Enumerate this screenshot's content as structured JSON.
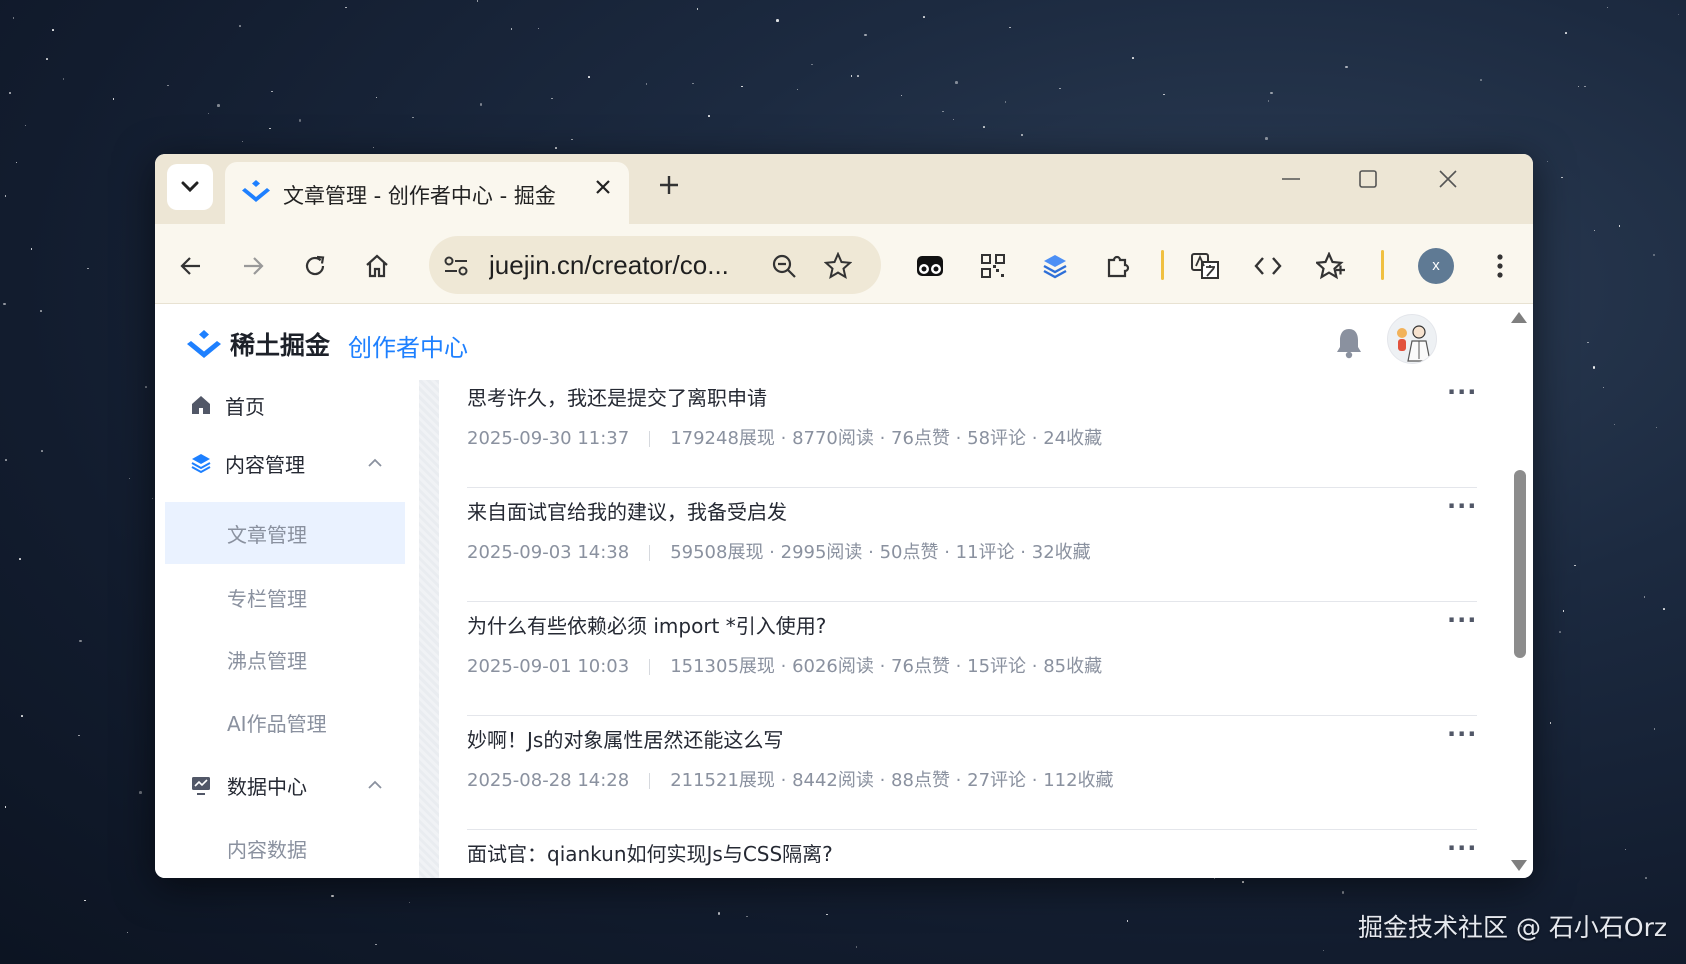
{
  "browser": {
    "tab_title": "文章管理 - 创作者中心 - 掘金",
    "url": "juejin.cn/creator/co...",
    "profile_initial": "x",
    "icons": [
      "chevron-down-icon",
      "juejin-logo-icon",
      "close-icon",
      "plus-icon",
      "minimize-icon",
      "maximize-icon",
      "window-close-icon",
      "back-icon",
      "forward-icon",
      "reload-icon",
      "home-icon",
      "site-info-icon",
      "zoom-icon",
      "bookmark-star-icon",
      "extension-glasses-icon",
      "qr-code-icon",
      "layers-extension-icon",
      "puzzle-icon",
      "translate-icon",
      "code-icon",
      "favorites-icon",
      "more-icon"
    ]
  },
  "header": {
    "brand": "稀土掘金",
    "subtitle": "创作者中心",
    "accent_color": "#1e80ff"
  },
  "sidebar": {
    "items": [
      {
        "label": "首页",
        "icon": "home-icon"
      },
      {
        "label": "内容管理",
        "icon": "layers-icon",
        "expanded": true
      },
      {
        "label": "文章管理",
        "active": true
      },
      {
        "label": "专栏管理"
      },
      {
        "label": "沸点管理"
      },
      {
        "label": "AI作品管理"
      },
      {
        "label": "数据中心",
        "icon": "chart-monitor-icon",
        "expanded": true
      },
      {
        "label": "内容数据"
      }
    ]
  },
  "articles": [
    {
      "title": "思考许久，我还是提交了离职申请",
      "date": "2025-09-30 11:37",
      "stats": "179248展现 · 8770阅读 · 76点赞 · 58评论 · 24收藏"
    },
    {
      "title": "来自面试官给我的建议，我备受启发",
      "date": "2025-09-03 14:38",
      "stats": "59508展现 · 2995阅读 · 50点赞 · 11评论 · 32收藏"
    },
    {
      "title": "为什么有些依赖必须 import *引入使用?",
      "date": "2025-09-01 10:03",
      "stats": "151305展现 · 6026阅读 · 76点赞 · 15评论 · 85收藏"
    },
    {
      "title": "妙啊！Js的对象属性居然还能这么写",
      "date": "2025-08-28 14:28",
      "stats": "211521展现 · 8442阅读 · 88点赞 · 27评论 · 112收藏"
    },
    {
      "title": "面试官：qiankun如何实现Js与CSS隔离?",
      "date": "",
      "stats": ""
    }
  ],
  "more_label": "···",
  "watermark": "掘金技术社区 @ 石小石Orz"
}
